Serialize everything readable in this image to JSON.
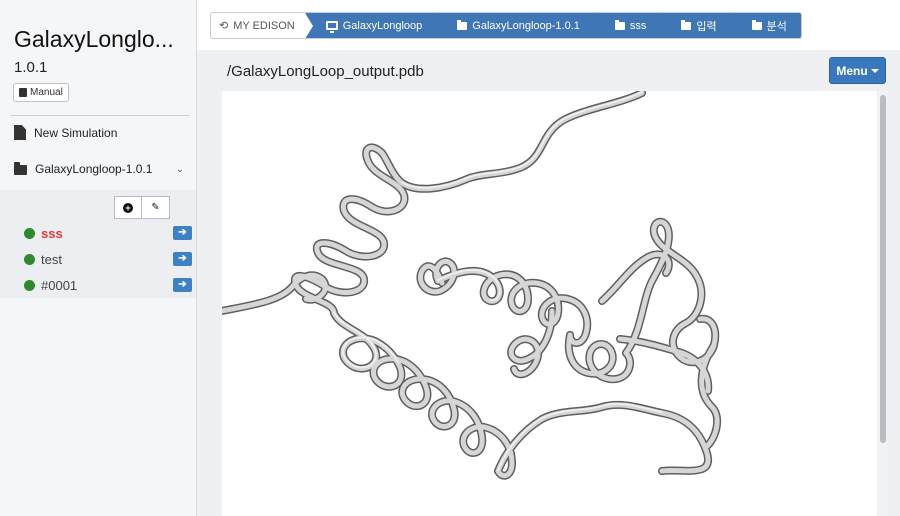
{
  "app": {
    "title": "GalaxyLonglo...",
    "version": "1.0.1",
    "manual_label": "Manual"
  },
  "sidebar": {
    "new_simulation": "New Simulation",
    "project": "GalaxyLongloop-1.0.1",
    "simulations": [
      {
        "label": "sss",
        "active": true
      },
      {
        "label": "test",
        "active": false
      },
      {
        "label": "#0001",
        "active": false
      }
    ]
  },
  "breadcrumb": {
    "home": "MY EDISON",
    "items": [
      "GalaxyLongloop",
      "GalaxyLongloop-1.0.1",
      "sss",
      "입력",
      "분석"
    ]
  },
  "content": {
    "file_title": "/GalaxyLongLoop_output.pdb",
    "menu_label": "Menu"
  },
  "colors": {
    "accent": "#3a78bd",
    "active_sim": "#e03b3b",
    "status_dot": "#2f8a2f"
  }
}
